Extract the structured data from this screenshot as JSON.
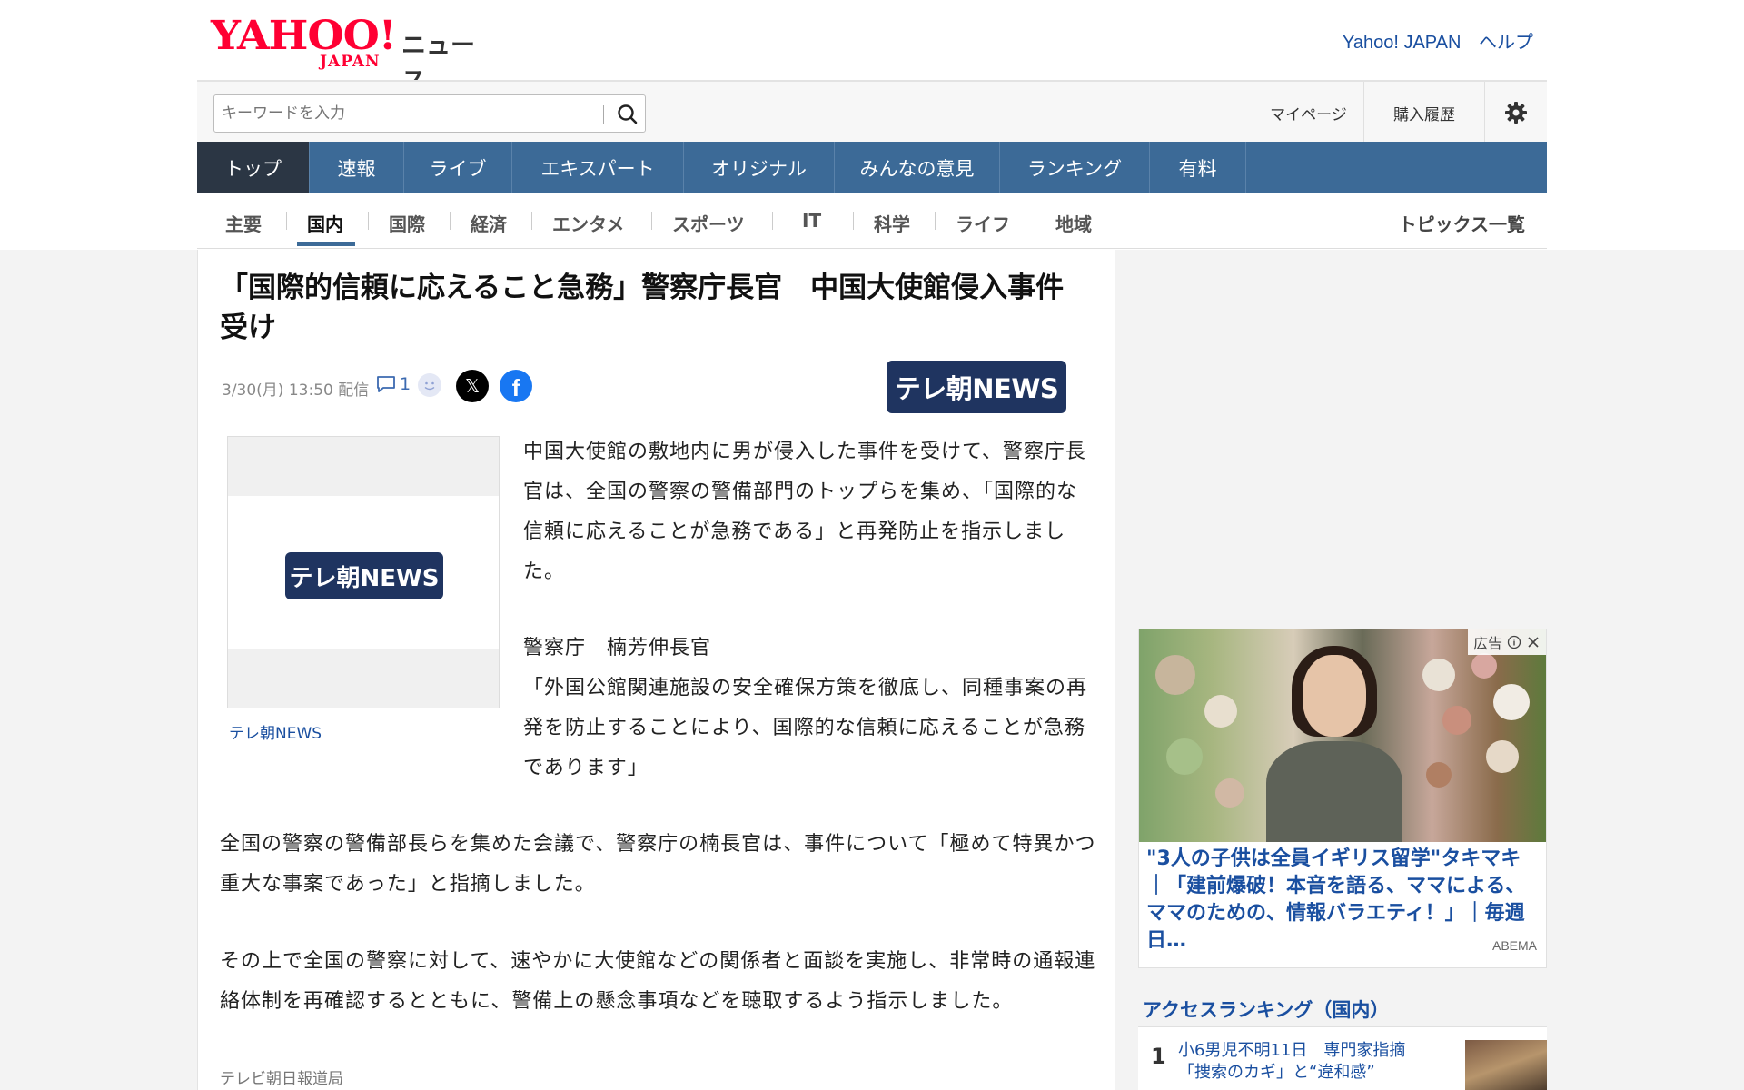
{
  "header": {
    "logo_main": "YAHOO!",
    "logo_sub": "JAPAN",
    "service_name": "ニュース",
    "links": [
      "Yahoo! JAPAN",
      "ヘルプ"
    ]
  },
  "search": {
    "placeholder": "キーワードを入力",
    "value": ""
  },
  "utility": {
    "mypage": "マイページ",
    "purchase_history": "購入履歴",
    "settings_icon": "gear-icon"
  },
  "nav_primary": [
    {
      "label": "トップ",
      "active": true
    },
    {
      "label": "速報"
    },
    {
      "label": "ライブ"
    },
    {
      "label": "エキスパート"
    },
    {
      "label": "オリジナル"
    },
    {
      "label": "みんなの意見"
    },
    {
      "label": "ランキング"
    },
    {
      "label": "有料"
    }
  ],
  "nav_categories": [
    {
      "label": "主要"
    },
    {
      "label": "国内",
      "active": true
    },
    {
      "label": "国際"
    },
    {
      "label": "経済"
    },
    {
      "label": "エンタメ"
    },
    {
      "label": "スポーツ"
    },
    {
      "label": "IT"
    },
    {
      "label": "科学"
    },
    {
      "label": "ライフ"
    },
    {
      "label": "地域"
    }
  ],
  "topics_link": "トピックス一覧",
  "article": {
    "title": "「国際的信頼に応えること急務」警察庁長官　中国大使館侵入事件受け",
    "published": "3/30(月) 13:50 配信",
    "comment_count": "1",
    "source_logo": "テレ朝NEWS",
    "photo_logo": "テレ朝NEWS",
    "photo_caption": "テレ朝NEWS",
    "paragraphs": [
      "中国大使館の敷地内に男が侵入した事件を受けて、警察庁長官は、全国の警察の警備部門のトップらを集め、「国際的な信頼に応えることが急務である」と再発防止を指示しました。",
      "警察庁　楠芳伸長官",
      "「外国公館関連施設の安全確保方策を徹底し、同種事案の再発を防止することにより、国際的な信頼に応えることが急務であります」",
      "全国の警察の警備部長らを集めた会議で、警察庁の楠長官は、事件について「極めて特異かつ重大な事案であった」と指摘しました。",
      "その上で全国の警察に対して、速やかに大使館などの関係者と面談を実施し、非常時の通報連絡体制を再確認するとともに、警備上の懸念事項などを聴取するよう指示しました。"
    ],
    "footer_source": "テレビ朝日報道局"
  },
  "ad": {
    "badge": "広告",
    "title": "\"3人の子供は全員イギリス留学\"タキマキ｜「建前爆破！本音を語る、ママによる、ママのための、情報バラエティ！」｜毎週日…",
    "sponsor": "ABEMA"
  },
  "ranking": {
    "title": "アクセスランキング（国内）",
    "items": [
      {
        "rank": "1",
        "text": "小6男児不明11日　専門家指摘「捜索のカギ」と“違和感”"
      }
    ]
  },
  "colors": {
    "nav_bg": "#3c6a97",
    "nav_active": "#2b3644",
    "link": "#1a4fa0",
    "brand_red": "#ff0033",
    "source_navy": "#1f3460"
  }
}
